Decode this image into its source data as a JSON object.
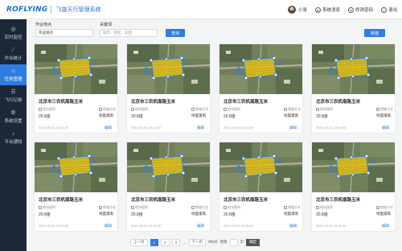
{
  "header": {
    "logo": "ROFLYING",
    "title": "飞旋天行管理系统",
    "user": "小张",
    "actions": [
      {
        "label": "系统消息",
        "icon": "bell-icon"
      },
      {
        "label": "修改密码",
        "icon": "lock-icon"
      },
      {
        "label": "退出",
        "icon": "power-icon"
      }
    ]
  },
  "sidebar": {
    "items": [
      {
        "label": "实时监控",
        "icon": "monitor-icon",
        "glyph": "◎",
        "active": false
      },
      {
        "label": "作业统计",
        "icon": "chart-icon",
        "glyph": "⟋",
        "active": false
      },
      {
        "label": "任务管理",
        "icon": "task-icon",
        "glyph": "⌂",
        "active": true
      },
      {
        "label": "飞行记录",
        "icon": "record-icon",
        "glyph": "☰",
        "active": false
      },
      {
        "label": "系统设置",
        "icon": "gear-icon",
        "glyph": "⚙",
        "active": false
      },
      {
        "label": "平台通知",
        "icon": "bell-icon",
        "glyph": "♪",
        "active": false
      }
    ]
  },
  "filters": {
    "field1_label": "作业地点",
    "field1_value": "作业地点",
    "field2_label": "关键词",
    "field2_placeholder": "城市、地区、农田",
    "query_label": "查询",
    "new_label": "新建"
  },
  "card_common": {
    "area_label": "地块面积",
    "spray_label": "喷施方式",
    "edit_label": "编辑"
  },
  "cards": [
    {
      "title": "北京市三农机南路玉米",
      "area": "20.8亩",
      "spray": "地面灌溉",
      "time": "2017-09-21 13:11:30"
    },
    {
      "title": "北京市三农机南路玉米",
      "area": "20.8亩",
      "spray": "地面灌溉",
      "time": "2017-09-21 13:11:30"
    },
    {
      "title": "北京市三农机南路玉米",
      "area": "20.8亩",
      "spray": "地面灌溉",
      "time": "2017-09-21 13:11:30"
    },
    {
      "title": "北京市三农机南路玉米",
      "area": "20.8亩",
      "spray": "地面灌溉",
      "time": "2017-09-21 13:11:30"
    },
    {
      "title": "北京市三农机南路玉米",
      "area": "20.8亩",
      "spray": "地面灌溉",
      "time": "2017-09-21 13:11:30"
    },
    {
      "title": "北京市三农机南路玉米",
      "area": "20.8亩",
      "spray": "地面灌溉",
      "time": "2017-09-21 13:11:30"
    },
    {
      "title": "北京市三农机南路玉米",
      "area": "20.8亩",
      "spray": "地面灌溉",
      "time": "2017-09-21 13:11:30"
    },
    {
      "title": "北京市三农机南路玉米",
      "area": "20.8亩",
      "spray": "地面灌溉",
      "time": "2017-09-21 13:11:30"
    }
  ],
  "pagination": {
    "prev": "上一页",
    "pages": [
      "1",
      "2",
      "3"
    ],
    "current": "1",
    "ellipsis": "…",
    "next": "下一页",
    "total": "共5页",
    "goto_label": "到第",
    "page_unit": "页",
    "confirm": "确定"
  },
  "colors": {
    "accent": "#2f7de1",
    "sidebar_bg": "#1b2838"
  }
}
